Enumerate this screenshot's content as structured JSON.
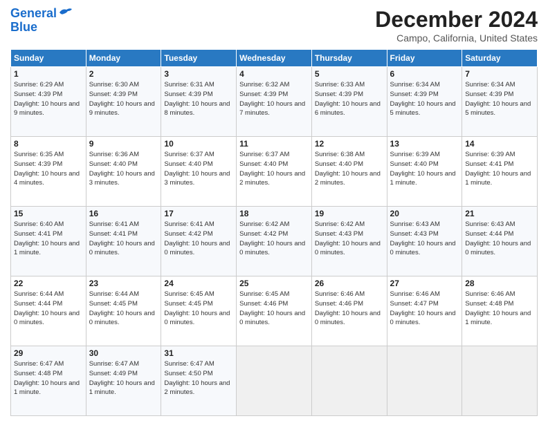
{
  "logo": {
    "line1": "General",
    "line2": "Blue"
  },
  "title": "December 2024",
  "location": "Campo, California, United States",
  "days_of_week": [
    "Sunday",
    "Monday",
    "Tuesday",
    "Wednesday",
    "Thursday",
    "Friday",
    "Saturday"
  ],
  "weeks": [
    [
      {
        "day": "1",
        "sunrise": "6:29 AM",
        "sunset": "4:39 PM",
        "daylight": "10 hours and 9 minutes."
      },
      {
        "day": "2",
        "sunrise": "6:30 AM",
        "sunset": "4:39 PM",
        "daylight": "10 hours and 9 minutes."
      },
      {
        "day": "3",
        "sunrise": "6:31 AM",
        "sunset": "4:39 PM",
        "daylight": "10 hours and 8 minutes."
      },
      {
        "day": "4",
        "sunrise": "6:32 AM",
        "sunset": "4:39 PM",
        "daylight": "10 hours and 7 minutes."
      },
      {
        "day": "5",
        "sunrise": "6:33 AM",
        "sunset": "4:39 PM",
        "daylight": "10 hours and 6 minutes."
      },
      {
        "day": "6",
        "sunrise": "6:34 AM",
        "sunset": "4:39 PM",
        "daylight": "10 hours and 5 minutes."
      },
      {
        "day": "7",
        "sunrise": "6:34 AM",
        "sunset": "4:39 PM",
        "daylight": "10 hours and 5 minutes."
      }
    ],
    [
      {
        "day": "8",
        "sunrise": "6:35 AM",
        "sunset": "4:39 PM",
        "daylight": "10 hours and 4 minutes."
      },
      {
        "day": "9",
        "sunrise": "6:36 AM",
        "sunset": "4:40 PM",
        "daylight": "10 hours and 3 minutes."
      },
      {
        "day": "10",
        "sunrise": "6:37 AM",
        "sunset": "4:40 PM",
        "daylight": "10 hours and 3 minutes."
      },
      {
        "day": "11",
        "sunrise": "6:37 AM",
        "sunset": "4:40 PM",
        "daylight": "10 hours and 2 minutes."
      },
      {
        "day": "12",
        "sunrise": "6:38 AM",
        "sunset": "4:40 PM",
        "daylight": "10 hours and 2 minutes."
      },
      {
        "day": "13",
        "sunrise": "6:39 AM",
        "sunset": "4:40 PM",
        "daylight": "10 hours and 1 minute."
      },
      {
        "day": "14",
        "sunrise": "6:39 AM",
        "sunset": "4:41 PM",
        "daylight": "10 hours and 1 minute."
      }
    ],
    [
      {
        "day": "15",
        "sunrise": "6:40 AM",
        "sunset": "4:41 PM",
        "daylight": "10 hours and 1 minute."
      },
      {
        "day": "16",
        "sunrise": "6:41 AM",
        "sunset": "4:41 PM",
        "daylight": "10 hours and 0 minutes."
      },
      {
        "day": "17",
        "sunrise": "6:41 AM",
        "sunset": "4:42 PM",
        "daylight": "10 hours and 0 minutes."
      },
      {
        "day": "18",
        "sunrise": "6:42 AM",
        "sunset": "4:42 PM",
        "daylight": "10 hours and 0 minutes."
      },
      {
        "day": "19",
        "sunrise": "6:42 AM",
        "sunset": "4:43 PM",
        "daylight": "10 hours and 0 minutes."
      },
      {
        "day": "20",
        "sunrise": "6:43 AM",
        "sunset": "4:43 PM",
        "daylight": "10 hours and 0 minutes."
      },
      {
        "day": "21",
        "sunrise": "6:43 AM",
        "sunset": "4:44 PM",
        "daylight": "10 hours and 0 minutes."
      }
    ],
    [
      {
        "day": "22",
        "sunrise": "6:44 AM",
        "sunset": "4:44 PM",
        "daylight": "10 hours and 0 minutes."
      },
      {
        "day": "23",
        "sunrise": "6:44 AM",
        "sunset": "4:45 PM",
        "daylight": "10 hours and 0 minutes."
      },
      {
        "day": "24",
        "sunrise": "6:45 AM",
        "sunset": "4:45 PM",
        "daylight": "10 hours and 0 minutes."
      },
      {
        "day": "25",
        "sunrise": "6:45 AM",
        "sunset": "4:46 PM",
        "daylight": "10 hours and 0 minutes."
      },
      {
        "day": "26",
        "sunrise": "6:46 AM",
        "sunset": "4:46 PM",
        "daylight": "10 hours and 0 minutes."
      },
      {
        "day": "27",
        "sunrise": "6:46 AM",
        "sunset": "4:47 PM",
        "daylight": "10 hours and 0 minutes."
      },
      {
        "day": "28",
        "sunrise": "6:46 AM",
        "sunset": "4:48 PM",
        "daylight": "10 hours and 1 minute."
      }
    ],
    [
      {
        "day": "29",
        "sunrise": "6:47 AM",
        "sunset": "4:48 PM",
        "daylight": "10 hours and 1 minute."
      },
      {
        "day": "30",
        "sunrise": "6:47 AM",
        "sunset": "4:49 PM",
        "daylight": "10 hours and 1 minute."
      },
      {
        "day": "31",
        "sunrise": "6:47 AM",
        "sunset": "4:50 PM",
        "daylight": "10 hours and 2 minutes."
      },
      null,
      null,
      null,
      null
    ]
  ]
}
